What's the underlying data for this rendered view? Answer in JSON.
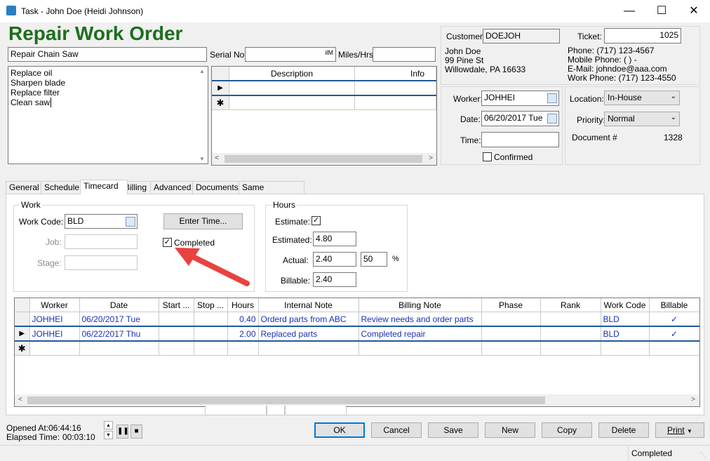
{
  "window": {
    "title": "Task - John Doe (Heidi Johnson)"
  },
  "heading": "Repair Work Order",
  "task": {
    "summary": "Repair Chain Saw",
    "serial_label": "Serial No.",
    "serial_value": "ilM",
    "miles_label": "Miles/Hrs",
    "miles_value": "",
    "notes": [
      "Replace oil",
      "Sharpen blade",
      "Replace filter",
      "Clean saw"
    ]
  },
  "desc_grid": {
    "headers": [
      "Description",
      "Info"
    ]
  },
  "customer": {
    "label": "Customer:",
    "code": "DOEJOH",
    "name": "John Doe",
    "address1": "99 Pine St",
    "address2": "Willowdale, PA 16633",
    "ticket_label": "Ticket:",
    "ticket": "1025",
    "phone": "Phone: (717) 123-4567",
    "mobile": "Mobile Phone: (   )    -",
    "email": "E-Mail: johndoe@aaa.com",
    "work_phone": "Work Phone: (717) 123-4550"
  },
  "assignment": {
    "worker_label": "Worker:",
    "worker": "JOHHEI",
    "date_label": "Date:",
    "date": "06/20/2017 Tue",
    "time_label": "Time:",
    "time": "",
    "confirmed_label": "Confirmed"
  },
  "location": {
    "location_label": "Location:",
    "location": "In-House",
    "priority_label": "Priority:",
    "priority": "Normal",
    "document_label": "Document #",
    "document": "1328"
  },
  "tabs": [
    "General",
    "Schedule",
    "Timecard",
    "Billing",
    "Advanced",
    "Documents",
    "Same Customer"
  ],
  "work": {
    "group_title": "Work",
    "work_code_label": "Work Code:",
    "work_code": "BLD",
    "job_label": "Job:",
    "stage_label": "Stage:",
    "enter_time_label": "Enter Time...",
    "completed_label": "Completed"
  },
  "hours": {
    "group_title": "Hours",
    "estimate_label": "Estimate:",
    "estimated_label": "Estimated:",
    "estimated": "4.80",
    "actual_label": "Actual:",
    "actual": "2.40",
    "percent": "50",
    "percent_sign": "%",
    "billable_label": "Billable:",
    "billable": "2.40"
  },
  "timecard": {
    "headers": [
      "Worker",
      "Date",
      "Start ...",
      "Stop ...",
      "Hours",
      "Internal Note",
      "Billing Note",
      "Phase",
      "Rank",
      "Work Code",
      "Billable"
    ],
    "rows": [
      {
        "worker": "JOHHEI",
        "date": "06/20/2017 Tue",
        "start": "",
        "stop": "",
        "hours": "0.40",
        "internal": "Orderd parts from ABC",
        "billing": "Review needs and order parts",
        "phase": "",
        "rank": "",
        "code": "BLD",
        "billable": "✓"
      },
      {
        "worker": "JOHHEI",
        "date": "06/22/2017 Thu",
        "start": "",
        "stop": "",
        "hours": "2.00",
        "internal": "Replaced parts",
        "billing": "Completed repair",
        "phase": "",
        "rank": "",
        "code": "BLD",
        "billable": "✓"
      }
    ]
  },
  "footer": {
    "opened_label": "Opened At:",
    "opened": "06:44:16",
    "elapsed_label": "Elapsed Time:",
    "elapsed": "00:03:10",
    "buttons": [
      "OK",
      "Cancel",
      "Save",
      "New",
      "Copy",
      "Delete",
      "Print"
    ],
    "status": "Completed"
  },
  "colors": {
    "heading": "#1d6f1d",
    "grid_text": "#1a2fb5",
    "arrow": "#e8433f",
    "selection": "#1f5a99"
  }
}
